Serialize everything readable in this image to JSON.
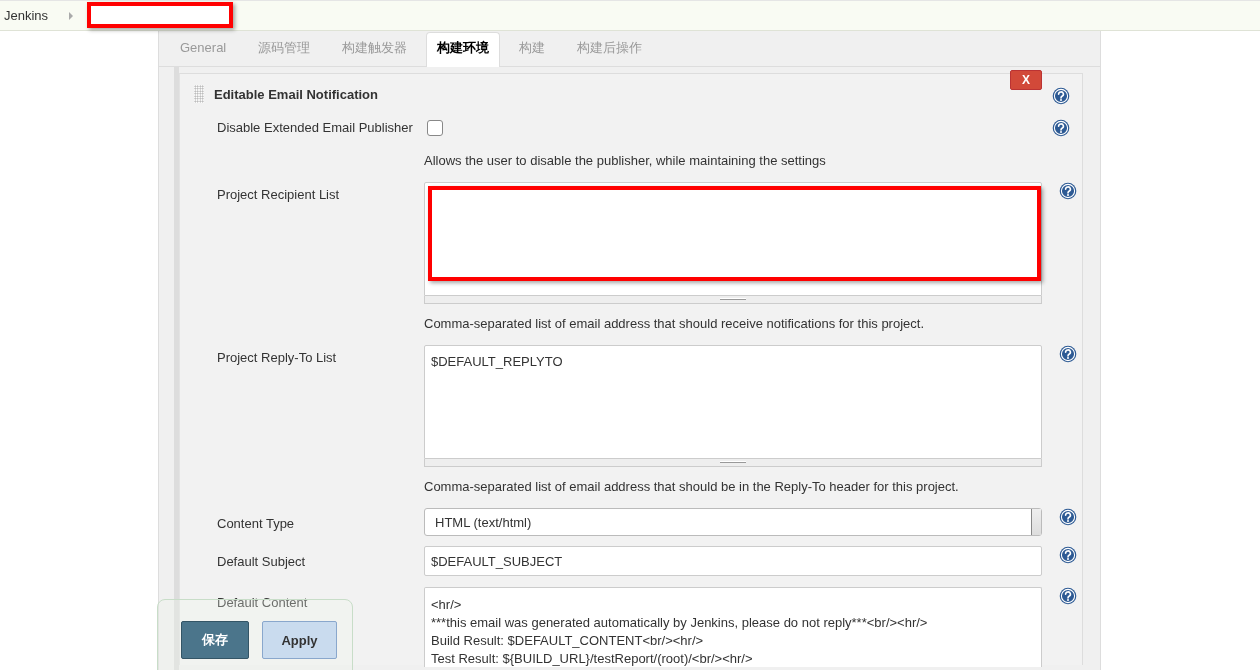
{
  "breadcrumb": [
    {
      "label": "Jenkins"
    }
  ],
  "tabs": [
    {
      "label": "General",
      "selected": false
    },
    {
      "label": "源码管理",
      "selected": false
    },
    {
      "label": "构建触发器",
      "selected": false
    },
    {
      "label": "构建环境",
      "selected": true
    },
    {
      "label": "构建",
      "selected": false
    },
    {
      "label": "构建后操作",
      "selected": false
    }
  ],
  "section": {
    "title": "Editable Email Notification",
    "delete_label": "X",
    "rows": [
      {
        "kind": "checkbox",
        "label": "Disable Extended Email Publisher",
        "checked": false,
        "help": "Allows the user to disable the publisher, while maintaining the settings"
      },
      {
        "kind": "textarea",
        "label": "Project Recipient List",
        "lines": [],
        "redacted": true,
        "help": "Comma-separated list of email address that should receive notifications for this project."
      },
      {
        "kind": "textarea",
        "label": "Project Reply-To List",
        "lines": [
          "$DEFAULT_REPLYTO"
        ],
        "redacted": false,
        "help": "Comma-separated list of email address that should be in the Reply-To header for this project."
      },
      {
        "kind": "select",
        "label": "Content Type",
        "value": "HTML (text/html)"
      },
      {
        "kind": "text",
        "label": "Default Subject",
        "value": "$DEFAULT_SUBJECT"
      },
      {
        "kind": "content",
        "label": "Default Content",
        "lines": [
          "<hr/>",
          "***this email was generated automatically by Jenkins,  please do not reply***<br/><hr/>",
          "Build Result: $DEFAULT_CONTENT<br/><hr/>",
          "Test Result: ${BUILD_URL}/testReport/(root)/<br/><hr/>"
        ]
      }
    ]
  },
  "buttons": [
    {
      "label": "保存",
      "kind": "primary"
    },
    {
      "label": "Apply",
      "kind": "secondary"
    }
  ]
}
